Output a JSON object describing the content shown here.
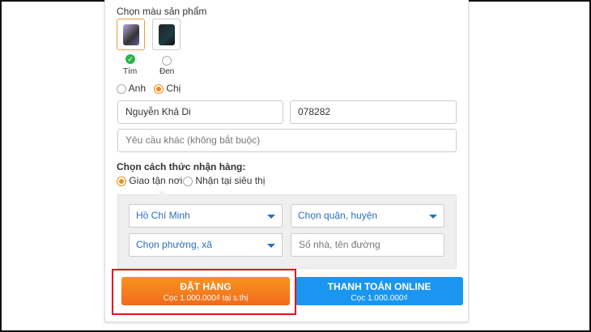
{
  "color_section": {
    "title": "Chọn màu sản phẩm",
    "options": [
      {
        "label": "Tím",
        "selected": true
      },
      {
        "label": "Đen",
        "selected": false
      }
    ]
  },
  "salutation": {
    "options": [
      "Anh",
      "Chị"
    ],
    "selected": "Chị"
  },
  "name_field": {
    "value": "Nguyễn Khả Di"
  },
  "phone_field": {
    "value": "078282"
  },
  "note_field": {
    "placeholder": "Yêu cầu khác (không bắt buộc)"
  },
  "delivery": {
    "title": "Chọn cách thức nhận hàng:",
    "options": [
      "Giao tận nơi",
      "Nhận tại siêu thị"
    ],
    "selected": "Giao tận nơi"
  },
  "address": {
    "city": "Hồ Chí Minh",
    "district": "Chọn quận, huyện",
    "ward": "Chọn phường, xã",
    "street_placeholder": "Số nhà, tên đường"
  },
  "order_button": {
    "title": "ĐẶT HÀNG",
    "subtitle": "Cọc 1.000.000₫ tại s.thị"
  },
  "online_button": {
    "title": "THANH TOÁN ONLINE",
    "subtitle": "Cọc 1.000.000₫"
  },
  "colors": {
    "orange": "#f28c16",
    "blue": "#1a96f0",
    "highlight": "#e0141e"
  }
}
